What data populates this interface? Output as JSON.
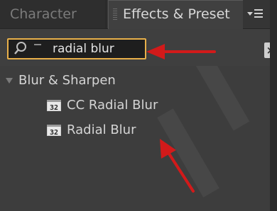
{
  "tabs": {
    "character": {
      "label": "Character"
    },
    "effects": {
      "label": "Effects & Preset"
    },
    "menu_icon": "panel-menu-icon"
  },
  "search": {
    "value": "radial blur",
    "search_icon": "search-icon",
    "clear_icon": "clear-icon",
    "clear_glyph": "×"
  },
  "tree": {
    "category": {
      "label": "Blur & Sharpen",
      "expanded": true
    },
    "items": [
      {
        "label": "CC Radial Blur",
        "icon": "effect-32bit-icon"
      },
      {
        "label": "Radial Blur",
        "icon": "effect-32bit-icon"
      }
    ]
  },
  "colors": {
    "search_border": "#e8b04a",
    "annotation_arrow": "#d21a1a"
  }
}
